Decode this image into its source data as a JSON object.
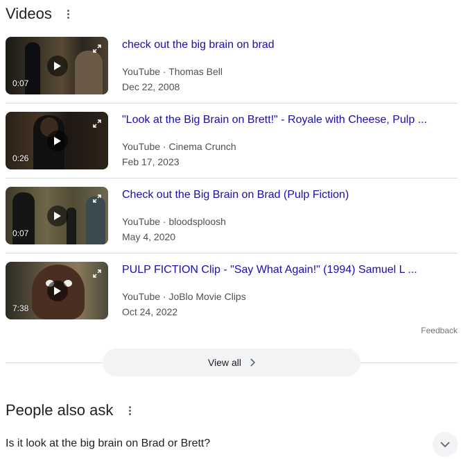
{
  "videos_section": {
    "title": "Videos",
    "items": [
      {
        "title": "check out the big brain on brad",
        "source": "YouTube · Thomas Bell",
        "date": "Dec 22, 2008",
        "duration": "0:07"
      },
      {
        "title": "\"Look at the Big Brain on Brett!\" - Royale with Cheese, Pulp ...",
        "source": "YouTube · Cinema Crunch",
        "date": "Feb 17, 2023",
        "duration": "0:26"
      },
      {
        "title": "Check out the Big Brain on Brad (Pulp Fiction)",
        "source": "YouTube · bloodsploosh",
        "date": "May 4, 2020",
        "duration": "0:07"
      },
      {
        "title": "PULP FICTION Clip - \"Say What Again!\" (1994) Samuel L ...",
        "source": "YouTube · JoBlo Movie Clips",
        "date": "Oct 24, 2022",
        "duration": "7:38"
      }
    ],
    "feedback": "Feedback",
    "view_all": "View all"
  },
  "people_also_ask": {
    "title": "People also ask",
    "questions": [
      "Is it look at the big brain on Brad or Brett?"
    ]
  },
  "colors": {
    "link": "#1a0dab",
    "text": "#202124",
    "secondary": "#4d5156",
    "divider": "#dadce0",
    "pill": "#f1f3f4"
  }
}
